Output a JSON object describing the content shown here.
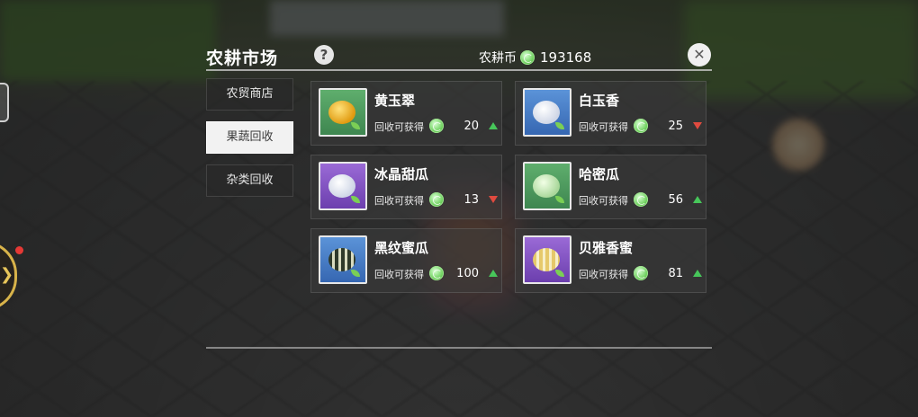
{
  "header": {
    "title": "农耕市场",
    "help_icon": "?",
    "currency_label": "农耕币",
    "currency_amount": "193168",
    "close_icon": "✕"
  },
  "nav": {
    "tabs": [
      {
        "label": "农贸商店",
        "active": false
      },
      {
        "label": "果蔬回收",
        "active": true
      },
      {
        "label": "杂类回收",
        "active": false
      }
    ]
  },
  "items": [
    {
      "name": "黄玉翠",
      "reward_label": "回收可获得",
      "value": "20",
      "trend": "up",
      "icon_bg": "green",
      "icon": "yellow-melon-icon"
    },
    {
      "name": "白玉香",
      "reward_label": "回收可获得",
      "value": "25",
      "trend": "down",
      "icon_bg": "blue",
      "icon": "white-melon-icon"
    },
    {
      "name": "冰晶甜瓜",
      "reward_label": "回收可获得",
      "value": "13",
      "trend": "down",
      "icon_bg": "purple",
      "icon": "white-melon-icon"
    },
    {
      "name": "哈密瓜",
      "reward_label": "回收可获得",
      "value": "56",
      "trend": "up",
      "icon_bg": "green",
      "icon": "green-melon-icon"
    },
    {
      "name": "黑纹蜜瓜",
      "reward_label": "回收可获得",
      "value": "100",
      "trend": "up",
      "icon_bg": "blue",
      "icon": "striped-melon-icon"
    },
    {
      "name": "贝雅香蜜",
      "reward_label": "回收可获得",
      "value": "81",
      "trend": "up",
      "icon_bg": "purple",
      "icon": "gold-melon-icon"
    }
  ],
  "colors": {
    "trend_up": "#47c65a",
    "trend_down": "#e04a3f",
    "active_tab": "#f2f2f2"
  }
}
